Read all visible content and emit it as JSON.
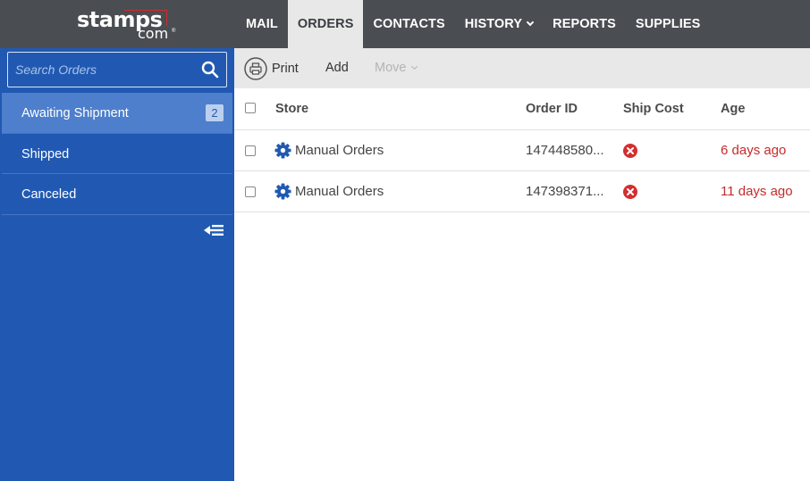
{
  "logo": {
    "primary": "stamps",
    "secondary": "com",
    "mark": "®"
  },
  "nav": {
    "items": [
      {
        "label": "MAIL"
      },
      {
        "label": "ORDERS"
      },
      {
        "label": "CONTACTS"
      },
      {
        "label": "HISTORY"
      },
      {
        "label": "REPORTS"
      },
      {
        "label": "SUPPLIES"
      }
    ],
    "active": "ORDERS"
  },
  "sidebar": {
    "search_placeholder": "Search Orders",
    "items": [
      {
        "label": "Awaiting Shipment",
        "count": "2"
      },
      {
        "label": "Shipped"
      },
      {
        "label": "Canceled"
      }
    ]
  },
  "toolbar": {
    "print_label": "Print",
    "add_label": "Add",
    "move_label": "Move"
  },
  "table": {
    "headers": {
      "store": "Store",
      "order_id": "Order ID",
      "ship_cost": "Ship Cost",
      "age": "Age"
    },
    "rows": [
      {
        "store": "Manual Orders",
        "order_id": "147448580...",
        "ship_cost_status": "error",
        "age": "6 days ago"
      },
      {
        "store": "Manual Orders",
        "order_id": "147398371...",
        "ship_cost_status": "error",
        "age": "11 days ago"
      }
    ]
  },
  "colors": {
    "topbar": "#4a4d52",
    "sidebar": "#2159b2",
    "sidebar_active": "#4d7fcc",
    "age_text": "#c72a2a",
    "error_icon": "#d32f2f",
    "gear_icon": "#2159b2"
  }
}
